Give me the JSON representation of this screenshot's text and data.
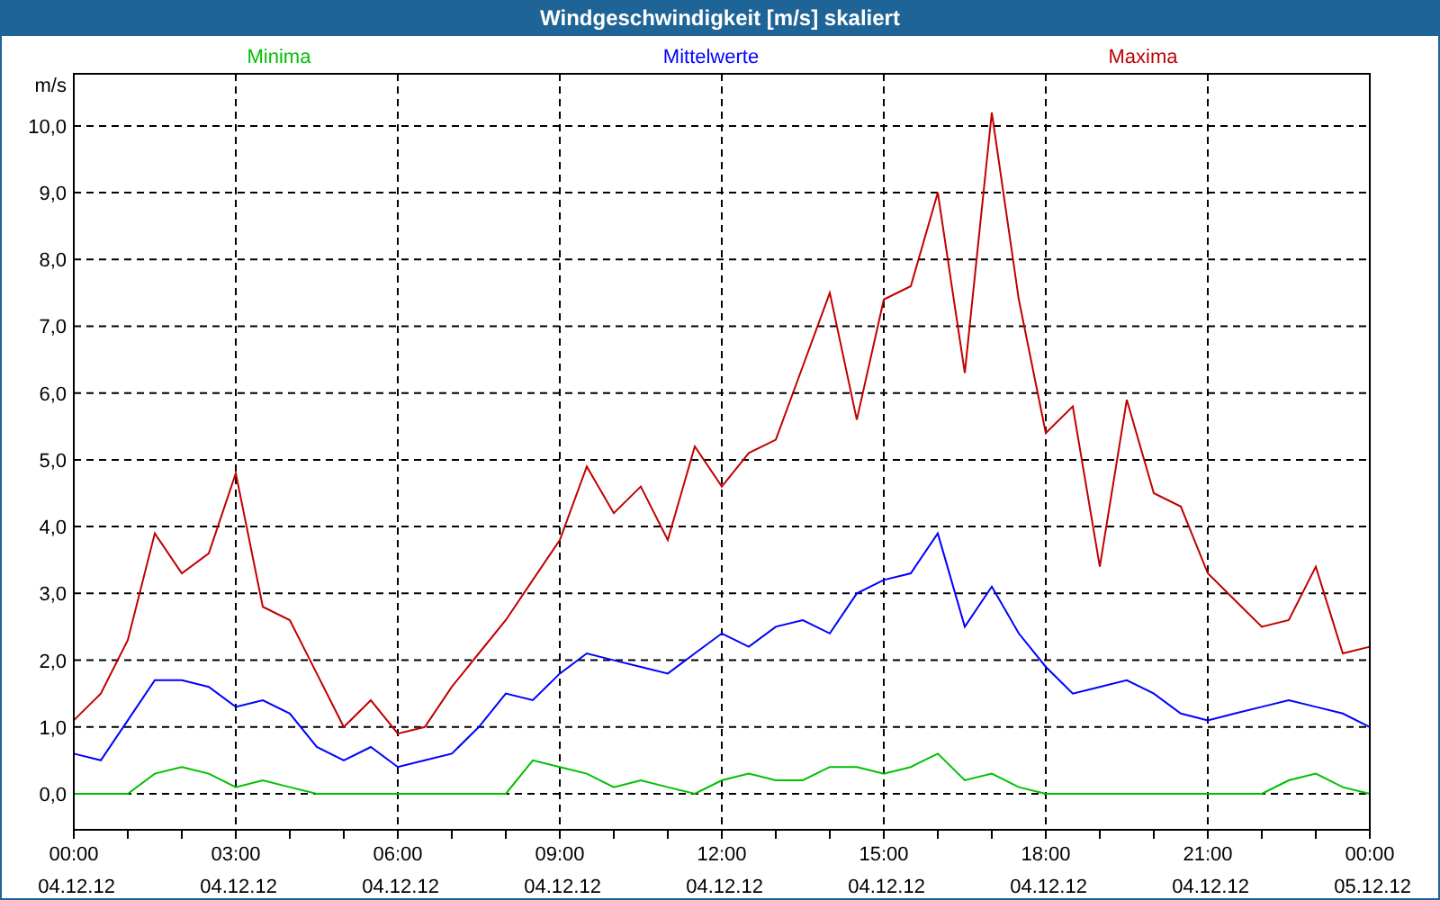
{
  "window": {
    "title": "Windgeschwindigkeit [m/s] skaliert"
  },
  "chart": {
    "chart_data": {
      "type": "line",
      "ylabel": "m/s",
      "categories": [
        "00:00 04.12.12",
        null,
        null,
        null,
        null,
        null,
        "03:00 04.12.12",
        null,
        null,
        null,
        null,
        null,
        "06:00 04.12.12",
        null,
        null,
        null,
        null,
        null,
        "09:00 04.12.12",
        null,
        null,
        null,
        null,
        null,
        "12:00 04.12.12",
        null,
        null,
        null,
        null,
        null,
        "15:00 04.12.12",
        null,
        null,
        null,
        null,
        null,
        "18:00 04.12.12",
        null,
        null,
        null,
        null,
        null,
        "21:00 04.12.12",
        null,
        null,
        null,
        null,
        null,
        "00:00 05.12.12"
      ],
      "series": [
        {
          "name": "Minima",
          "color": "#00c000",
          "values": [
            0,
            0,
            0,
            0.3,
            0.4,
            0.3,
            0.1,
            0.2,
            0.1,
            0,
            0,
            0,
            0,
            0,
            0,
            0,
            0,
            0.5,
            0.4,
            0.3,
            0.1,
            0.2,
            0.1,
            0,
            0.2,
            0.3,
            0.2,
            0.2,
            0.4,
            0.4,
            0.3,
            0.4,
            0.6,
            0.2,
            0.3,
            0.1,
            0,
            0,
            0,
            0,
            0,
            0,
            0,
            0,
            0,
            0.2,
            0.3,
            0.1,
            0
          ]
        },
        {
          "name": "Mittelwerte",
          "color": "#0000ff",
          "values": [
            0.6,
            0.5,
            1.1,
            1.7,
            1.7,
            1.6,
            1.3,
            1.4,
            1.2,
            0.7,
            0.5,
            0.7,
            0.4,
            0.5,
            0.6,
            1.0,
            1.5,
            1.4,
            1.8,
            2.1,
            2.0,
            1.9,
            1.8,
            2.1,
            2.4,
            2.2,
            2.5,
            2.6,
            2.4,
            3.0,
            3.2,
            3.3,
            3.9,
            2.5,
            3.1,
            2.4,
            1.9,
            1.5,
            1.6,
            1.7,
            1.5,
            1.2,
            1.1,
            1.2,
            1.3,
            1.4,
            1.3,
            1.2,
            1.0
          ]
        },
        {
          "name": "Maxima",
          "color": "#c00000",
          "values": [
            1.1,
            1.5,
            2.3,
            3.9,
            3.3,
            3.6,
            4.8,
            2.8,
            2.6,
            1.8,
            1.0,
            1.4,
            0.9,
            1.0,
            1.6,
            2.1,
            2.6,
            3.2,
            3.8,
            4.9,
            4.2,
            4.6,
            3.8,
            5.2,
            4.6,
            5.1,
            5.3,
            6.4,
            7.5,
            5.6,
            7.4,
            7.6,
            9.0,
            6.3,
            10.2,
            7.4,
            5.4,
            5.8,
            3.4,
            5.9,
            4.5,
            4.3,
            3.3,
            2.9,
            2.5,
            2.6,
            3.4,
            2.1,
            2.2
          ]
        }
      ],
      "ylim": [
        -0.54,
        10.78
      ],
      "grid": true,
      "yticks": [
        {
          "value": 0,
          "label": "0,0"
        },
        {
          "value": 1,
          "label": "1,0"
        },
        {
          "value": 2,
          "label": "2,0"
        },
        {
          "value": 3,
          "label": "3,0"
        },
        {
          "value": 4,
          "label": "4,0"
        },
        {
          "value": 5,
          "label": "5,0"
        },
        {
          "value": 6,
          "label": "6,0"
        },
        {
          "value": 7,
          "label": "7,0"
        },
        {
          "value": 8,
          "label": "8,0"
        },
        {
          "value": 9,
          "label": "9,0"
        },
        {
          "value": 10,
          "label": "10,0"
        }
      ]
    }
  }
}
